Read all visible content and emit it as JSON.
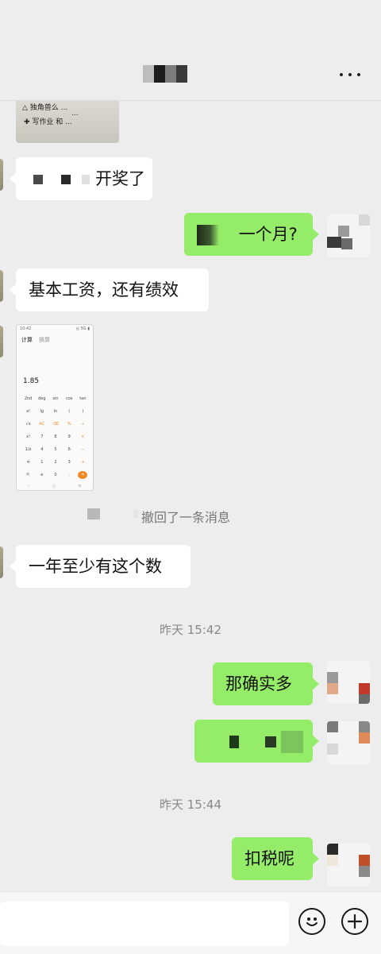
{
  "header": {
    "more_label": "···"
  },
  "messages": {
    "m1": {
      "text": "开奖了"
    },
    "m2": {
      "text": "一个月?"
    },
    "m3": {
      "text": "基本工资，还有绩效"
    },
    "m4": {
      "text": "一年至少有这个数"
    },
    "m5": {
      "text": "那确实多"
    },
    "m6": {
      "text": "扣税呢"
    }
  },
  "calculator_screenshot": {
    "tab_calc": "计算",
    "tab_convert": "换算",
    "value": "1.85",
    "keys": [
      "2nd",
      "deg",
      "sin",
      "cos",
      "tan",
      "xʸ",
      "lg",
      "ln",
      "(",
      ")",
      "√x",
      "AC",
      "⌫",
      "%",
      "÷",
      "x!",
      "7",
      "8",
      "9",
      "×",
      "1/x",
      "4",
      "5",
      "6",
      "−",
      "π",
      "1",
      "2",
      "3",
      "+",
      "⇱",
      "e",
      "0",
      ".",
      "="
    ]
  },
  "system": {
    "recalled": "撤回了一条消息"
  },
  "timestamps": {
    "t1": "昨天 15:42",
    "t2": "昨天 15:44"
  },
  "colors": {
    "outgoing_bubble": "#95ec69",
    "incoming_bubble": "#ffffff",
    "background": "#ededed",
    "accent": "#f08a24"
  },
  "icons": {
    "emoji": "emoji-icon",
    "add": "plus-icon",
    "more": "more-icon"
  }
}
